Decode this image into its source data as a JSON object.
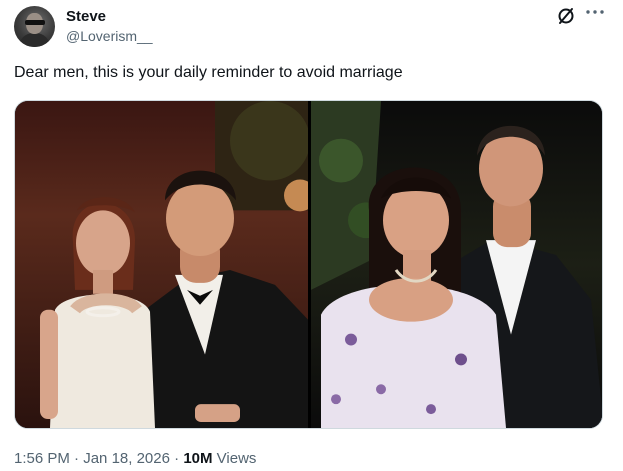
{
  "post": {
    "author_name": "Steve",
    "author_handle": "@Loverism__",
    "text": "Dear men, this is your daily reminder to avoid marriage",
    "time": "1:56 PM",
    "separator": "·",
    "date": "Jan 18, 2026",
    "views_count": "10M",
    "views_label": "Views"
  },
  "media": {
    "images": [
      {
        "name": "left-photo"
      },
      {
        "name": "right-photo"
      }
    ]
  },
  "icons": {
    "grok": "grok-icon",
    "more": "more-options-icon"
  },
  "colors": {
    "text_primary": "#0f1419",
    "text_secondary": "#536471",
    "border": "#cfd9de"
  }
}
